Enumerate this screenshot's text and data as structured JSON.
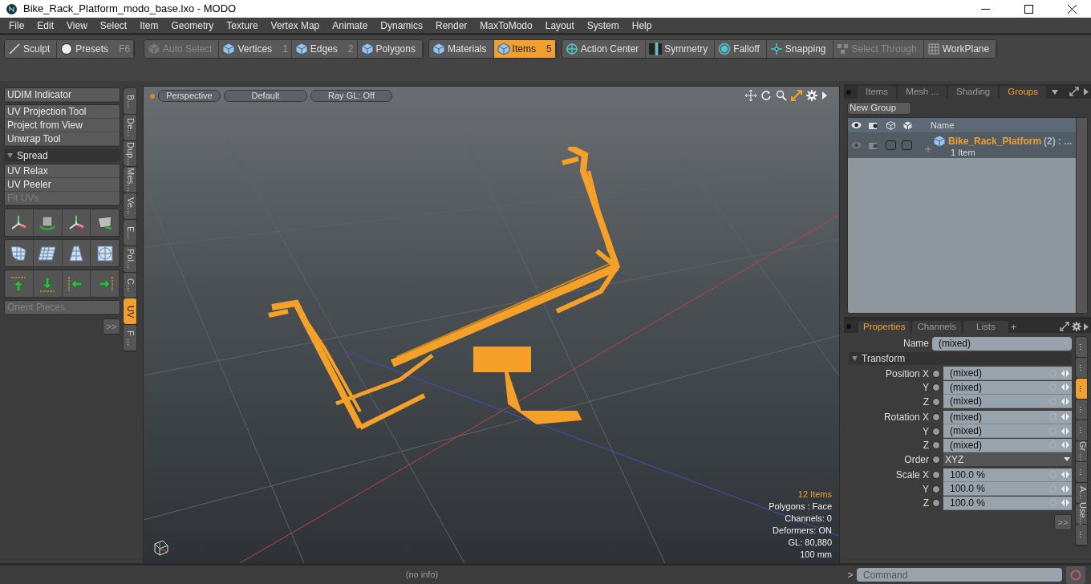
{
  "window": {
    "title": "Bike_Rack_Platform_modo_base.lxo - MODO"
  },
  "menu": [
    "File",
    "Edit",
    "View",
    "Select",
    "Item",
    "Geometry",
    "Texture",
    "Vertex Map",
    "Animate",
    "Dynamics",
    "Render",
    "MaxToModo",
    "Layout",
    "System",
    "Help"
  ],
  "toolbar": [
    [
      {
        "label": "Sculpt",
        "disabled": false,
        "selected": false
      },
      {
        "label": "Presets",
        "shortcut": "F6",
        "disabled": false,
        "selected": false
      }
    ],
    [
      {
        "label": "Auto Select",
        "disabled": true,
        "selected": false
      },
      {
        "label": "Vertices",
        "shortcut": "1",
        "disabled": false,
        "selected": false
      },
      {
        "label": "Edges",
        "shortcut": "2",
        "disabled": false,
        "selected": false
      },
      {
        "label": "Polygons",
        "disabled": false,
        "selected": false
      }
    ],
    [
      {
        "label": "Materials",
        "disabled": false,
        "selected": false
      },
      {
        "label": "Items",
        "shortcut": "5",
        "disabled": false,
        "selected": true
      }
    ],
    [
      {
        "label": "Action Center",
        "disabled": false,
        "selected": false
      },
      {
        "label": "Symmetry",
        "disabled": false,
        "selected": false
      },
      {
        "label": "Falloff",
        "disabled": false,
        "selected": false
      },
      {
        "label": "Snapping",
        "disabled": false,
        "selected": false
      },
      {
        "label": "Select Through",
        "disabled": true,
        "selected": false
      },
      {
        "label": "WorkPlane",
        "disabled": false,
        "selected": false
      }
    ]
  ],
  "tool_panel": {
    "groups": [
      {
        "kind": "buttons",
        "items": [
          {
            "label": "UDIM Indicator",
            "disabled": false
          }
        ]
      },
      {
        "kind": "buttons",
        "items": [
          {
            "label": "UV Projection Tool",
            "disabled": false
          },
          {
            "label": "Project from View",
            "disabled": false
          },
          {
            "label": "Unwrap Tool",
            "disabled": false
          }
        ]
      },
      {
        "kind": "section",
        "label": "Spread"
      },
      {
        "kind": "buttons",
        "items": [
          {
            "label": "UV Relax",
            "disabled": false
          },
          {
            "label": "UV Peeler",
            "disabled": false
          },
          {
            "label": "Fit UVs",
            "disabled": true
          }
        ]
      },
      {
        "kind": "icons"
      },
      {
        "kind": "buttons",
        "items": [
          {
            "label": "Orient Pieces",
            "disabled": true
          }
        ]
      }
    ],
    "more": ">>",
    "side_tabs": [
      {
        "label": "B...",
        "selected": false
      },
      {
        "label": "De...",
        "selected": false
      },
      {
        "label": "Dup...",
        "selected": false
      },
      {
        "label": "Mes...",
        "selected": false
      },
      {
        "label": "Ve...",
        "selected": false
      },
      {
        "label": "E...",
        "selected": false
      },
      {
        "label": "Pol...",
        "selected": false
      },
      {
        "label": "C...",
        "selected": false
      },
      {
        "label": "UV",
        "selected": true
      },
      {
        "label": "F ...",
        "selected": false
      }
    ]
  },
  "viewport": {
    "buttons": [
      "Perspective",
      "Default",
      "Ray GL: Off"
    ],
    "stats": [
      {
        "text": "12 Items",
        "highlight": true
      },
      {
        "text": "Polygons : Face",
        "highlight": false
      },
      {
        "text": "Channels: 0",
        "highlight": false
      },
      {
        "text": "Deformers: ON",
        "highlight": false
      },
      {
        "text": "GL: 80,880",
        "highlight": false
      },
      {
        "text": "100 mm",
        "highlight": false
      }
    ]
  },
  "groups_panel": {
    "tabs": [
      {
        "label": "Items",
        "selected": false
      },
      {
        "label": "Mesh ...",
        "selected": false
      },
      {
        "label": "Shading",
        "selected": false
      },
      {
        "label": "Groups",
        "selected": true
      }
    ],
    "new_button": "New Group",
    "name_header": "Name",
    "rows": [
      {
        "name": "Bike_Rack_Platform",
        "count": "(2) : ...",
        "detail": "1 Item",
        "toggles": [
          {
            "checked": false
          },
          {
            "checked": false
          }
        ]
      }
    ]
  },
  "properties_panel": {
    "tabs": [
      {
        "label": "Properties",
        "selected": true
      },
      {
        "label": "Channels",
        "selected": false
      },
      {
        "label": "Lists",
        "selected": false
      }
    ],
    "add_tab": "+",
    "name_label": "Name",
    "name_value": "(mixed)",
    "section": "Transform",
    "field_groups": [
      [
        {
          "label": "Position X",
          "value": "(mixed)",
          "kind": "number"
        },
        {
          "label": "Y",
          "value": "(mixed)",
          "kind": "number"
        },
        {
          "label": "Z",
          "value": "(mixed)",
          "kind": "number"
        }
      ],
      [
        {
          "label": "Rotation X",
          "value": "(mixed)",
          "kind": "number"
        },
        {
          "label": "Y",
          "value": "(mixed)",
          "kind": "number"
        },
        {
          "label": "Z",
          "value": "(mixed)",
          "kind": "number"
        },
        {
          "label": "Order",
          "value": "XYZ",
          "kind": "dropdown"
        }
      ],
      [
        {
          "label": "Scale X",
          "value": "100.0 %",
          "kind": "number"
        },
        {
          "label": "Y",
          "value": "100.0 %",
          "kind": "number"
        },
        {
          "label": "Z",
          "value": "100.0 %",
          "kind": "number"
        }
      ]
    ],
    "more": ">>",
    "side_tabs": [
      {
        "label": "...",
        "selected": false
      },
      {
        "label": "...",
        "selected": false
      },
      {
        "label": "...",
        "selected": true
      },
      {
        "label": "...",
        "selected": false
      },
      {
        "label": "...",
        "selected": false
      },
      {
        "label": "Gr ...",
        "selected": false
      },
      {
        "label": "...",
        "selected": false
      },
      {
        "label": "A...",
        "selected": false
      },
      {
        "label": "Use...",
        "selected": false
      },
      {
        "label": "...",
        "selected": false
      }
    ]
  },
  "status_bar": {
    "info": "(no info)",
    "prompt": ">",
    "command_placeholder": "Command"
  }
}
